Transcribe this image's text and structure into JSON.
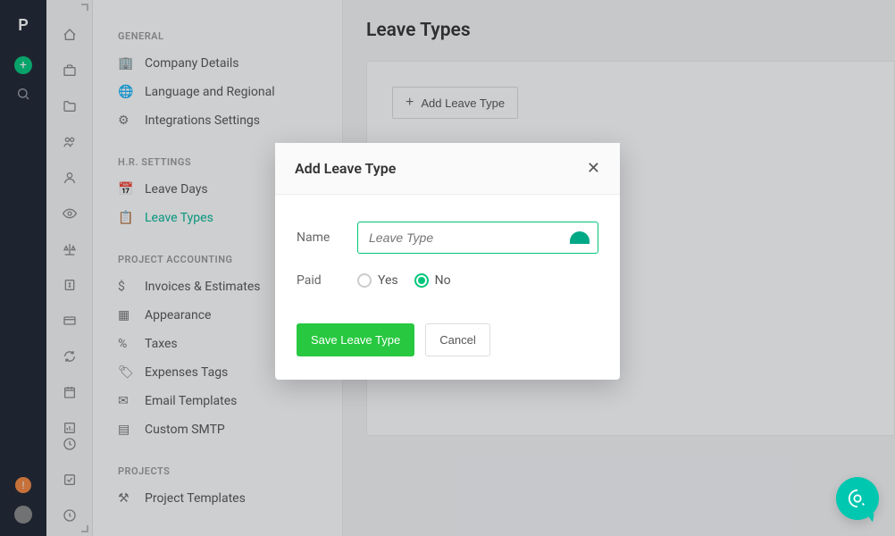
{
  "rail": {
    "logo": "P"
  },
  "sidebar": {
    "groups": [
      {
        "label": "GENERAL",
        "items": [
          {
            "icon": "🏢",
            "label": "Company Details"
          },
          {
            "icon": "🌐",
            "label": "Language and Regional"
          },
          {
            "icon": "⚙",
            "label": "Integrations Settings"
          }
        ]
      },
      {
        "label": "H.R. SETTINGS",
        "items": [
          {
            "icon": "📅",
            "label": "Leave Days"
          },
          {
            "icon": "📋",
            "label": "Leave Types"
          }
        ]
      },
      {
        "label": "PROJECT ACCOUNTING",
        "items": [
          {
            "icon": "$",
            "label": "Invoices & Estimates"
          },
          {
            "icon": "▦",
            "label": "Appearance"
          },
          {
            "icon": "%",
            "label": "Taxes"
          },
          {
            "icon": "🏷",
            "label": "Expenses Tags"
          },
          {
            "icon": "✉",
            "label": "Email Templates"
          },
          {
            "icon": "▤",
            "label": "Custom SMTP"
          }
        ]
      },
      {
        "label": "PROJECTS",
        "items": [
          {
            "icon": "👤⚙",
            "label": "Project Templates"
          }
        ]
      }
    ]
  },
  "main": {
    "title": "Leave Types",
    "add_button": "Add Leave Type"
  },
  "modal": {
    "title": "Add Leave Type",
    "name_label": "Name",
    "name_placeholder": "Leave Type",
    "paid_label": "Paid",
    "yes": "Yes",
    "no": "No",
    "save": "Save Leave Type",
    "cancel": "Cancel"
  }
}
